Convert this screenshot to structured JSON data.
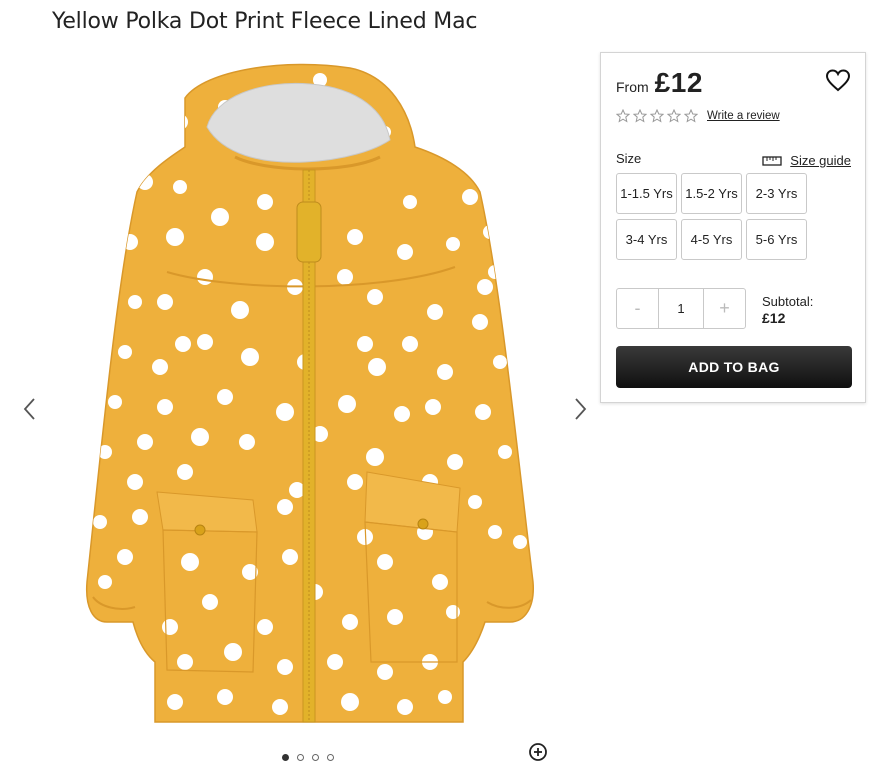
{
  "product": {
    "title": "Yellow Polka Dot Print Fleece Lined Mac",
    "image_name": "yellow-polka-dot-mac-image",
    "colors": {
      "jacket": "#eeb03c",
      "dots": "#ffffff",
      "lining": "#dedede",
      "accent": "#e2b22a"
    }
  },
  "gallery": {
    "prev_icon": "chevron-left-icon",
    "next_icon": "chevron-right-icon",
    "dot_count": 4,
    "active_dot": 0,
    "zoom_icon": "zoom-in-icon"
  },
  "purchase": {
    "from_label": "From",
    "price": "£12",
    "wishlist_icon": "heart-icon",
    "rating_stars": 0,
    "rating_max": 5,
    "review_link": "Write a review",
    "size_label": "Size",
    "size_guide_label": "Size guide",
    "size_guide_icon": "ruler-icon",
    "sizes": [
      "1-1.5 Yrs",
      "1.5-2 Yrs",
      "2-3 Yrs",
      "3-4 Yrs",
      "4-5 Yrs",
      "5-6 Yrs"
    ],
    "quantity": {
      "decrement": "-",
      "value": "1",
      "increment": "+"
    },
    "subtotal_label": "Subtotal:",
    "subtotal_value": "£12",
    "add_button": "ADD TO BAG",
    "button_color": "#1c1c1c"
  }
}
